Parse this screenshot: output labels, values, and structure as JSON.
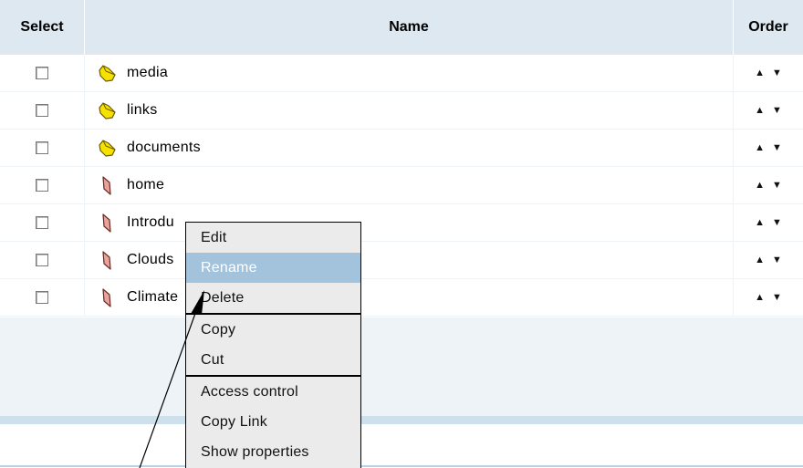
{
  "table": {
    "columns": {
      "select": "Select",
      "name": "Name",
      "order": "Order"
    },
    "rows": [
      {
        "name": "media",
        "type": "folder"
      },
      {
        "name": "links",
        "type": "folder"
      },
      {
        "name": "documents",
        "type": "folder"
      },
      {
        "name": "home",
        "type": "page"
      },
      {
        "name": "Introdu",
        "type": "page"
      },
      {
        "name": "Clouds",
        "type": "page"
      },
      {
        "name": "Climate",
        "type": "page"
      }
    ],
    "order_up": "▲",
    "order_down": "▼"
  },
  "context_menu": {
    "groups": [
      [
        {
          "label": "Edit"
        },
        {
          "label": "Rename",
          "highlighted": true
        },
        {
          "label": "Delete"
        }
      ],
      [
        {
          "label": "Copy"
        },
        {
          "label": "Cut"
        }
      ],
      [
        {
          "label": "Access control"
        },
        {
          "label": "Copy Link"
        },
        {
          "label": "Show properties"
        }
      ]
    ]
  },
  "colors": {
    "header_bg": "#dde8f0",
    "menu_bg": "#ebebeb",
    "menu_highlight": "#a2c3db",
    "folder_fill": "#f5e200",
    "page_fill": "#e8a39b"
  },
  "icons": {
    "folder": "folder-icon",
    "page": "page-icon"
  }
}
